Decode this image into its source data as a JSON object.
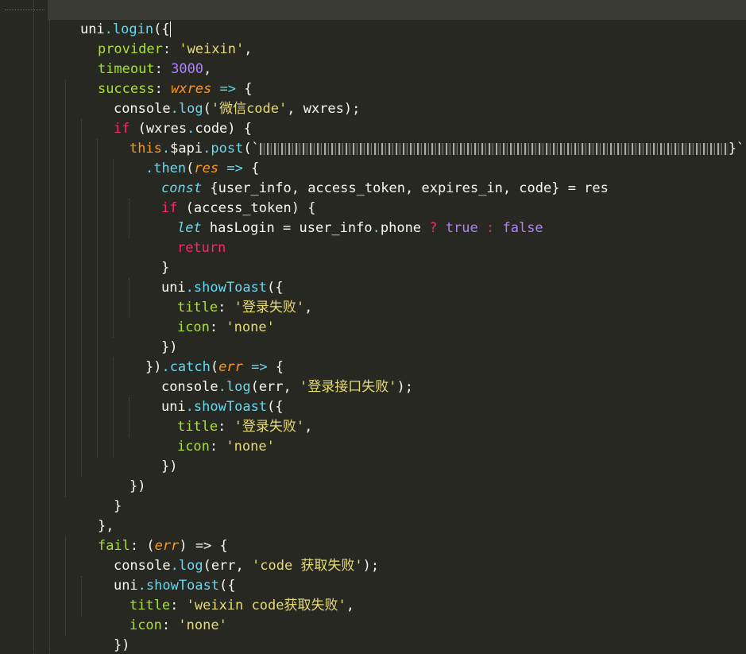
{
  "editor": {
    "theme_colors": {
      "background": "#272822",
      "text": "#f8f8f2",
      "function": "#66d9ef",
      "keyword": "#f92672",
      "property": "#a6e22e",
      "string": "#e6db74",
      "number": "#ae81ff",
      "parameter": "#fd971f"
    },
    "code": {
      "l1_obj": "uni",
      "l1_dot": ".",
      "l1_fn": "login",
      "l1_open": "({",
      "l2_key": "provider",
      "l2_colon": ": ",
      "l2_val": "'weixin'",
      "l2_end": ",",
      "l3_key": "timeout",
      "l3_colon": ": ",
      "l3_val": "3000",
      "l3_end": ",",
      "l4_key": "success",
      "l4_colon": ": ",
      "l4_param": "wxres",
      "l4_arrow": " => ",
      "l4_open": "{",
      "l5_obj": "console",
      "l5_dot": ".",
      "l5_fn": "log",
      "l5_open": "(",
      "l5_str": "'微信code'",
      "l5_rest": ", wxres);",
      "l6_kw": "if",
      "l6_a": " (wxres",
      "l6_dot": ".",
      "l6_b": "code) {",
      "l7_this": "this",
      "l7_dot": ".",
      "l7_api": "$api",
      "l7_dot2": ".",
      "l7_fn": "post",
      "l7_open": "(`",
      "l7_tail": "}`)",
      "l8_dot": ".",
      "l8_fn": "then",
      "l8_open": "(",
      "l8_param": "res",
      "l8_arrow": " => ",
      "l8_brace": "{",
      "l9_kw": "const",
      "l9_rest": " {user_info, access_token, expires_in, code} = res",
      "l10_kw": "if",
      "l10_rest": " (access_token) {",
      "l11_kw": "let",
      "l11_a": " hasLogin = user_info",
      "l11_dot": ".",
      "l11_b": "phone ",
      "l11_q": "?",
      "l11_sp": " ",
      "l11_true": "true",
      "l11_sp2": " ",
      "l11_colon": ":",
      "l11_sp3": " ",
      "l11_false": "false",
      "l12_kw": "return",
      "l13_close": "}",
      "l14_obj": "uni",
      "l14_dot": ".",
      "l14_fn": "showToast",
      "l14_open": "({",
      "l15_key": "title",
      "l15_colon": ": ",
      "l15_val": "'登录失败'",
      "l15_end": ",",
      "l16_key": "icon",
      "l16_colon": ": ",
      "l16_val": "'none'",
      "l17_close": "})",
      "l18_close": "})",
      "l18_dot": ".",
      "l18_fn": "catch",
      "l18_open": "(",
      "l18_param": "err",
      "l18_arrow": " => ",
      "l18_brace": "{",
      "l19_obj": "console",
      "l19_dot": ".",
      "l19_fn": "log",
      "l19_open": "(err, ",
      "l19_str": "'登录接口失败'",
      "l19_end": ");",
      "l20_obj": "uni",
      "l20_dot": ".",
      "l20_fn": "showToast",
      "l20_open": "({",
      "l21_key": "title",
      "l21_colon": ": ",
      "l21_val": "'登录失败'",
      "l21_end": ",",
      "l22_key": "icon",
      "l22_colon": ": ",
      "l22_val": "'none'",
      "l23_close": "})",
      "l24_close": "})",
      "l25_close": "}",
      "l26_close": "},",
      "l27_key": "fail",
      "l27_colon": ": (",
      "l27_param": "err",
      "l27_arrow": ") => ",
      "l27_open": "{",
      "l28_obj": "console",
      "l28_dot": ".",
      "l28_fn": "log",
      "l28_open": "(err, ",
      "l28_str": "'code 获取失败'",
      "l28_end": ");",
      "l29_obj": "uni",
      "l29_dot": ".",
      "l29_fn": "showToast",
      "l29_open": "({",
      "l30_key": "title",
      "l30_colon": ": ",
      "l30_val": "'weixin code获取失败'",
      "l30_end": ",",
      "l31_key": "icon",
      "l31_colon": ": ",
      "l31_val": "'none'",
      "l32_close": "})",
      "l33_close": "}"
    }
  }
}
